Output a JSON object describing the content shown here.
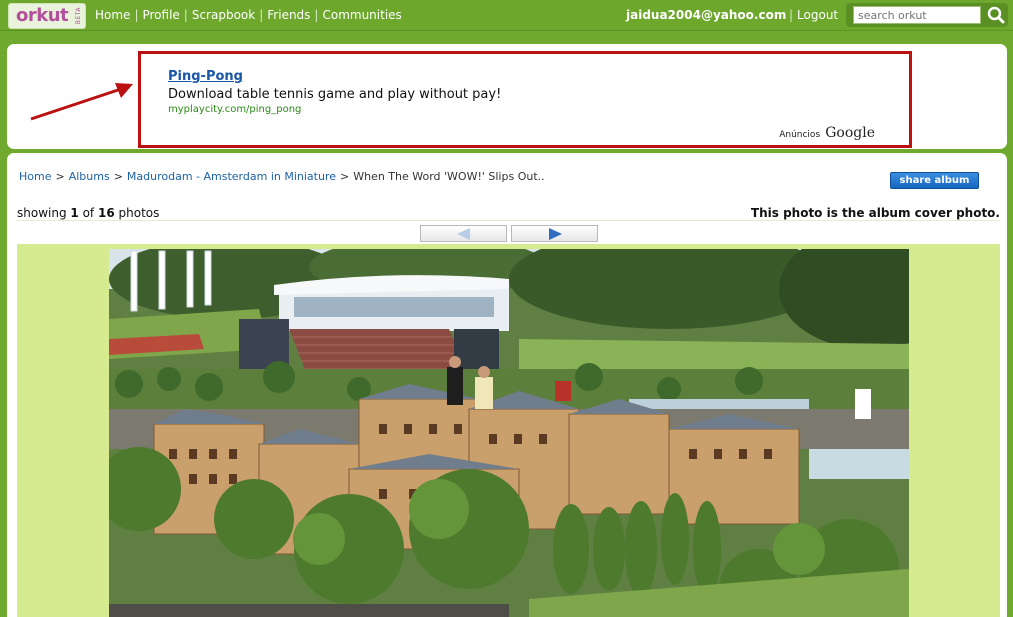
{
  "header": {
    "logo_text": "orkut",
    "logo_beta": "BETA",
    "nav": [
      "Home",
      "Profile",
      "Scrapbook",
      "Friends",
      "Communities"
    ],
    "user_email": "jaidua2004@yahoo.com",
    "logout_label": "Logout",
    "search_placeholder": "search orkut"
  },
  "ad": {
    "title": "Ping-Pong",
    "text": "Download table tennis game and play without pay!",
    "url": "myplaycity.com/ping_pong",
    "anuncios": "Anúncios",
    "google": "Google"
  },
  "album": {
    "breadcrumb": [
      "Home",
      "Albums",
      "Madurodam - Amsterdam in Miniature"
    ],
    "current_photo_title": "When The Word 'WOW!' Slips Out..",
    "share_label": "share album",
    "showing_prefix": "showing",
    "current_index": "1",
    "of_word": "of",
    "total": "16",
    "photos_word": "photos",
    "cover_note": "This photo is the album cover photo."
  },
  "colors": {
    "topbar": "#6da82d",
    "logo_purple": "#b3509b",
    "link_blue": "#1d62a8",
    "ad_border": "#bb1111",
    "photo_frame": "#d6ea8f"
  }
}
